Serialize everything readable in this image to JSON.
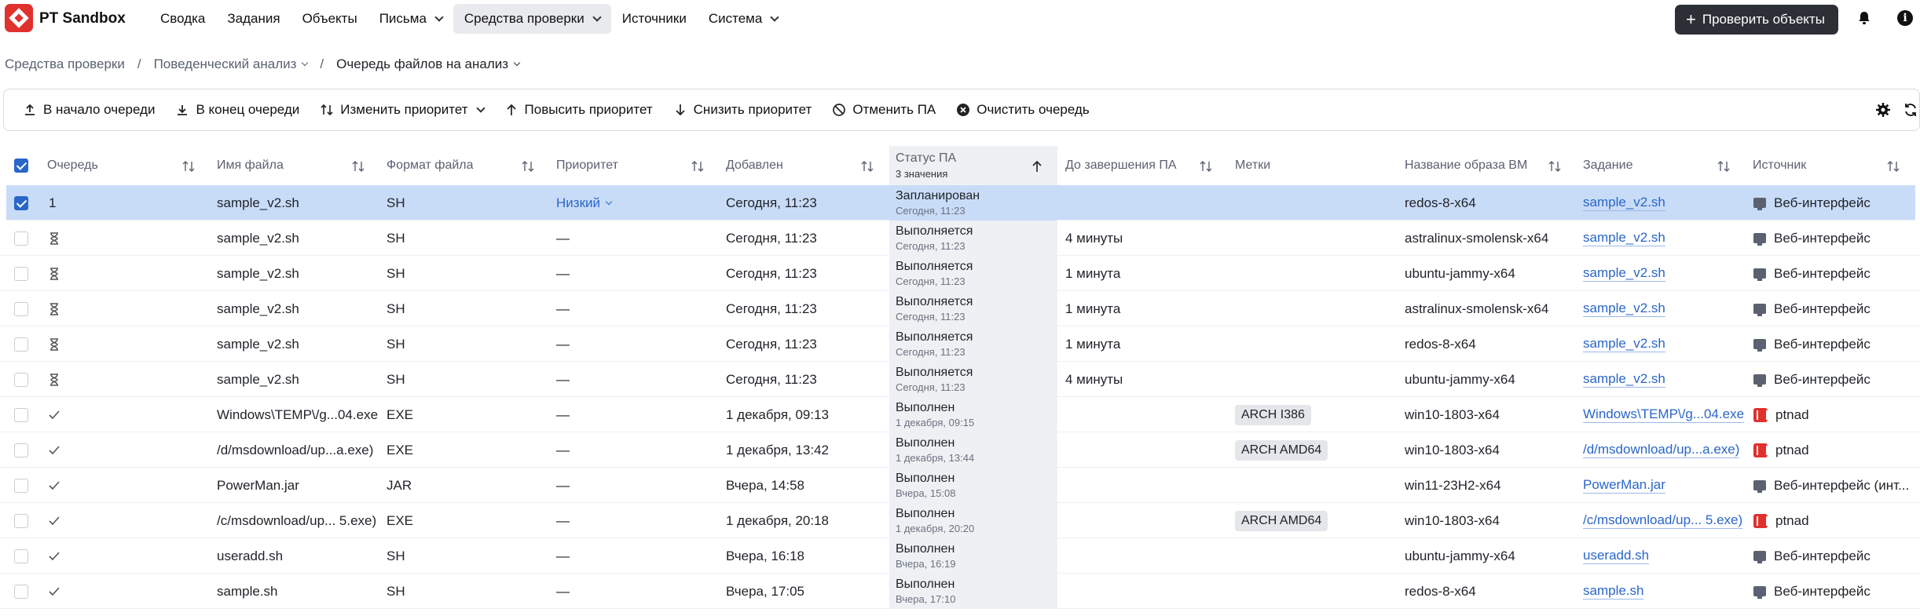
{
  "app": {
    "brand": "PT Sandbox"
  },
  "nav": {
    "items": [
      {
        "label": "Сводка",
        "dropdown": false,
        "active": false
      },
      {
        "label": "Задания",
        "dropdown": false,
        "active": false
      },
      {
        "label": "Объекты",
        "dropdown": false,
        "active": false
      },
      {
        "label": "Письма",
        "dropdown": true,
        "active": false
      },
      {
        "label": "Средства проверки",
        "dropdown": true,
        "active": true
      },
      {
        "label": "Источники",
        "dropdown": false,
        "active": false
      },
      {
        "label": "Система",
        "dropdown": true,
        "active": false
      }
    ],
    "check_button": "Проверить объекты"
  },
  "breadcrumb": {
    "items": [
      "Средства проверки",
      "Поведенческий анализ",
      "Очередь файлов на анализ"
    ]
  },
  "toolbar": {
    "to_start": "В начало очереди",
    "to_end": "В конец очереди",
    "change_priority": "Изменить приоритет",
    "raise_priority": "Повысить приоритет",
    "lower_priority": "Снизить приоритет",
    "cancel": "Отменить ПА",
    "clear": "Очистить очередь"
  },
  "table": {
    "columns": {
      "queue": "Очередь",
      "filename": "Имя файла",
      "format": "Формат файла",
      "priority": "Приоритет",
      "added": "Добавлен",
      "status": "Статус ПА",
      "status_sub": "3 значения",
      "remaining": "До завершения ПА",
      "tags": "Метки",
      "vm": "Название образа ВМ",
      "task": "Задание",
      "source": "Источник"
    },
    "rows": [
      {
        "queue": "1",
        "queue_icon": "none",
        "checked": true,
        "filename": "sample_v2.sh",
        "format": "SH",
        "priority": "Низкий",
        "priority_link": true,
        "added": "Сегодня, 11:23",
        "status": "Запланирован",
        "status_time": "Сегодня, 11:23",
        "remaining": "",
        "tag": "",
        "vm": "redos-8-x64",
        "task": "sample_v2.sh",
        "source": "Веб-интерфейс",
        "source_icon": "monitor-icon"
      },
      {
        "queue": "",
        "queue_icon": "hourglass-icon",
        "checked": false,
        "filename": "sample_v2.sh",
        "format": "SH",
        "priority": "—",
        "priority_link": false,
        "added": "Сегодня, 11:23",
        "status": "Выполняется",
        "status_time": "Сегодня, 11:23",
        "remaining": "4 минуты",
        "tag": "",
        "vm": "astralinux-smolensk-x64",
        "task": "sample_v2.sh",
        "source": "Веб-интерфейс",
        "source_icon": "monitor-icon"
      },
      {
        "queue": "",
        "queue_icon": "hourglass-icon",
        "checked": false,
        "filename": "sample_v2.sh",
        "format": "SH",
        "priority": "—",
        "priority_link": false,
        "added": "Сегодня, 11:23",
        "status": "Выполняется",
        "status_time": "Сегодня, 11:23",
        "remaining": "1 минута",
        "tag": "",
        "vm": "ubuntu-jammy-x64",
        "task": "sample_v2.sh",
        "source": "Веб-интерфейс",
        "source_icon": "monitor-icon"
      },
      {
        "queue": "",
        "queue_icon": "hourglass-icon",
        "checked": false,
        "filename": "sample_v2.sh",
        "format": "SH",
        "priority": "—",
        "priority_link": false,
        "added": "Сегодня, 11:23",
        "status": "Выполняется",
        "status_time": "Сегодня, 11:23",
        "remaining": "1 минута",
        "tag": "",
        "vm": "astralinux-smolensk-x64",
        "task": "sample_v2.sh",
        "source": "Веб-интерфейс",
        "source_icon": "monitor-icon"
      },
      {
        "queue": "",
        "queue_icon": "hourglass-icon",
        "checked": false,
        "filename": "sample_v2.sh",
        "format": "SH",
        "priority": "—",
        "priority_link": false,
        "added": "Сегодня, 11:23",
        "status": "Выполняется",
        "status_time": "Сегодня, 11:23",
        "remaining": "1 минута",
        "tag": "",
        "vm": "redos-8-x64",
        "task": "sample_v2.sh",
        "source": "Веб-интерфейс",
        "source_icon": "monitor-icon"
      },
      {
        "queue": "",
        "queue_icon": "hourglass-icon",
        "checked": false,
        "filename": "sample_v2.sh",
        "format": "SH",
        "priority": "—",
        "priority_link": false,
        "added": "Сегодня, 11:23",
        "status": "Выполняется",
        "status_time": "Сегодня, 11:23",
        "remaining": "4 минуты",
        "tag": "",
        "vm": "ubuntu-jammy-x64",
        "task": "sample_v2.sh",
        "source": "Веб-интерфейс",
        "source_icon": "monitor-icon"
      },
      {
        "queue": "",
        "queue_icon": "checkmark-icon",
        "checked": false,
        "filename": "Windows\\TEMP\\/g...04.exe",
        "format": "EXE",
        "priority": "—",
        "priority_link": false,
        "added": "1 декабря, 09:13",
        "status": "Выполнен",
        "status_time": "1 декабря, 09:15",
        "remaining": "",
        "tag": "ARCH I386",
        "vm": "win10-1803-x64",
        "task": "Windows\\TEMP\\/g...04.exe",
        "source": "ptnad",
        "source_icon": "ptnad-icon"
      },
      {
        "queue": "",
        "queue_icon": "checkmark-icon",
        "checked": false,
        "filename": "/d/msdownload/up...a.exe)",
        "format": "EXE",
        "priority": "—",
        "priority_link": false,
        "added": "1 декабря, 13:42",
        "status": "Выполнен",
        "status_time": "1 декабря, 13:44",
        "remaining": "",
        "tag": "ARCH AMD64",
        "vm": "win10-1803-x64",
        "task": "/d/msdownload/up...a.exe)",
        "source": "ptnad",
        "source_icon": "ptnad-icon"
      },
      {
        "queue": "",
        "queue_icon": "checkmark-icon",
        "checked": false,
        "filename": "PowerMan.jar",
        "format": "JAR",
        "priority": "—",
        "priority_link": false,
        "added": "Вчера, 14:58",
        "status": "Выполнен",
        "status_time": "Вчера, 15:08",
        "remaining": "",
        "tag": "",
        "vm": "win11-23H2-x64",
        "task": "PowerMan.jar",
        "source": "Веб-интерфейс (инт...",
        "source_icon": "monitor-icon"
      },
      {
        "queue": "",
        "queue_icon": "checkmark-icon",
        "checked": false,
        "filename": "/c/msdownload/up... 5.exe)",
        "format": "EXE",
        "priority": "—",
        "priority_link": false,
        "added": "1 декабря, 20:18",
        "status": "Выполнен",
        "status_time": "1 декабря, 20:20",
        "remaining": "",
        "tag": "ARCH AMD64",
        "vm": "win10-1803-x64",
        "task": "/c/msdownload/up... 5.exe)",
        "source": "ptnad",
        "source_icon": "ptnad-icon"
      },
      {
        "queue": "",
        "queue_icon": "checkmark-icon",
        "checked": false,
        "filename": "useradd.sh",
        "format": "SH",
        "priority": "—",
        "priority_link": false,
        "added": "Вчера, 16:18",
        "status": "Выполнен",
        "status_time": "Вчера, 16:19",
        "remaining": "",
        "tag": "",
        "vm": "ubuntu-jammy-x64",
        "task": "useradd.sh",
        "source": "Веб-интерфейс",
        "source_icon": "monitor-icon"
      },
      {
        "queue": "",
        "queue_icon": "checkmark-icon",
        "checked": false,
        "filename": "sample.sh",
        "format": "SH",
        "priority": "—",
        "priority_link": false,
        "added": "Вчера, 17:05",
        "status": "Выполнен",
        "status_time": "Вчера, 17:10",
        "remaining": "",
        "tag": "",
        "vm": "redos-8-x64",
        "task": "sample.sh",
        "source": "Веб-интерфейс",
        "source_icon": "monitor-icon"
      }
    ]
  },
  "colors": {
    "accent": "#2a66c9",
    "brand": "#e0312d",
    "selected_row": "#c9dcf7",
    "dark_button": "#2c2f36"
  }
}
